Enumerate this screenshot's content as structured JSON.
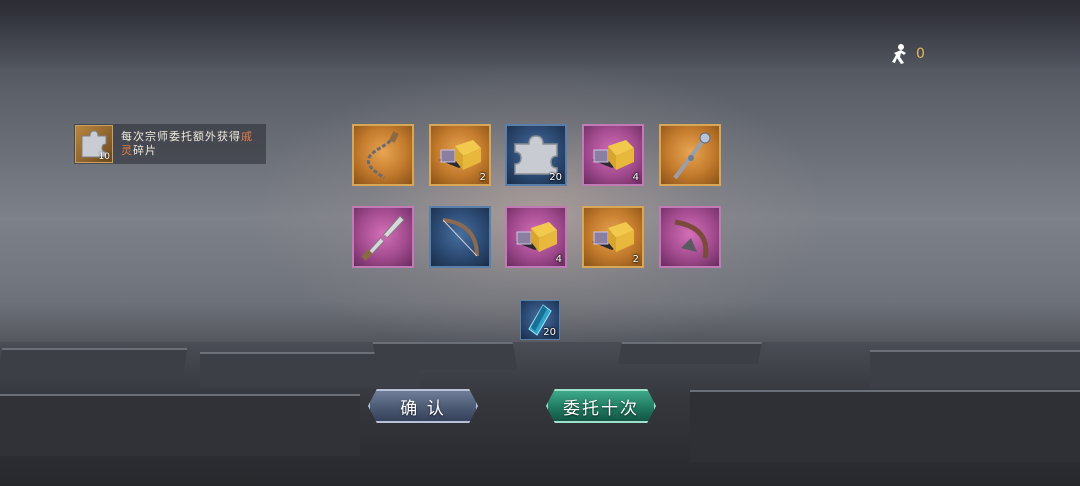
{
  "top_counter": {
    "icon": "figure-icon",
    "value": "0"
  },
  "bonus": {
    "icon": "puzzle-piece-icon",
    "count": "10",
    "text_before": "每次宗师委托额外获得",
    "text_highlight": "戚灵",
    "text_after": "碎片",
    "highlight_color": "#e27a4a"
  },
  "rewards": [
    {
      "item": "whip-chain-icon",
      "rarity": "gold",
      "count": ""
    },
    {
      "item": "gold-ingot-chest-icon",
      "rarity": "gold",
      "count": "2"
    },
    {
      "item": "puzzle-piece-icon",
      "rarity": "blue",
      "count": "20"
    },
    {
      "item": "gold-ingot-chest-icon",
      "rarity": "purple",
      "count": "4"
    },
    {
      "item": "ornate-staff-icon",
      "rarity": "gold",
      "count": ""
    },
    {
      "item": "ornate-dagger-icon",
      "rarity": "purple",
      "count": ""
    },
    {
      "item": "bow-icon",
      "rarity": "blue",
      "count": ""
    },
    {
      "item": "gold-ingot-chest-icon",
      "rarity": "purple",
      "count": "4"
    },
    {
      "item": "gold-ingot-chest-icon",
      "rarity": "gold",
      "count": "2"
    },
    {
      "item": "dragon-bow-icon",
      "rarity": "purple",
      "count": ""
    }
  ],
  "extra_reward": {
    "item": "blue-crystal-icon",
    "rarity": "blue",
    "count": "20"
  },
  "buttons": {
    "confirm": "确 认",
    "entrust_ten": "委托十次"
  },
  "colors": {
    "gold_frame": "#d8a657",
    "purple_frame": "#c07ab5",
    "blue_frame": "#5a7fa8",
    "confirm_btn": "#4c5a74",
    "entrust_btn": "#207a60",
    "counter_text": "#e8b85a"
  }
}
